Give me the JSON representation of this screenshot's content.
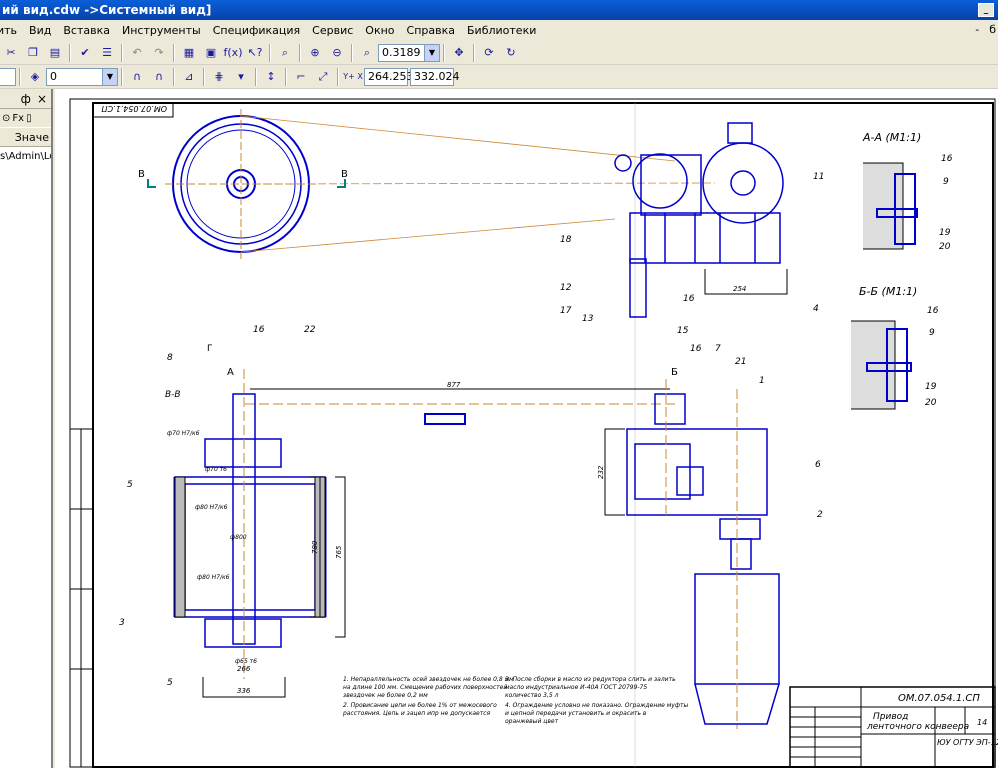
{
  "window": {
    "title": "ий вид.cdw ->Системный вид]",
    "restore_label": "_"
  },
  "menu": {
    "items": [
      "ить",
      "Вид",
      "Вставка",
      "Инструменты",
      "Спецификация",
      "Сервис",
      "Окно",
      "Справка",
      "Библиотеки"
    ],
    "right_controls": [
      "-",
      "б"
    ]
  },
  "toolbar1": {
    "zoom_value": "0.3189"
  },
  "toolbar2": {
    "layer_value": "0",
    "coord_x": "264.253",
    "coord_y": "332.024",
    "coord_label": "Y+ X"
  },
  "left_panel": {
    "header_controls": [
      "ф",
      "×"
    ],
    "column_header": "Значе",
    "row_text": "s\\Admin\\Lo"
  },
  "drawing": {
    "stamp_top": "ОМ.07.054.1.СП",
    "drawing_title_1": "Привод",
    "drawing_title_2": "ленточного конвеера",
    "sheet_number": "14",
    "group_code": "ЮУ ОГТУ ЭП-123",
    "corner_code": "ОМ.07.054.1.СП",
    "section_aa": "А-А (М1:1)",
    "section_bb": "Б-Б (М1:1)",
    "view_vv": "В-В",
    "view_g": "Г",
    "label_a": "А",
    "label_b": "Б",
    "label_v": "В",
    "dim_center": "877",
    "dim_254": "254",
    "dim_232": "232",
    "dim_780": "780",
    "dim_765": "765",
    "dim_336": "336",
    "dim_266": "266",
    "fit_1": "ф70 Н7/к6",
    "fit_2": "ф70 т6",
    "fit_3": "ф80 Н7/к6",
    "fit_4": "ф800",
    "fit_5": "ф80 Н7/к6",
    "fit_6": "ф65 т6",
    "part_numbers": [
      "16",
      "22",
      "8",
      "5",
      "3",
      "5",
      "1",
      "7",
      "21",
      "16",
      "6",
      "2",
      "11",
      "18",
      "12",
      "17",
      "13",
      "15",
      "16",
      "4",
      "16",
      "9",
      "19",
      "20",
      "16",
      "9",
      "19",
      "20"
    ],
    "notes_left_1": "1. Непараллельность осей звездочек не более 0,8 мм",
    "notes_left_2": "на длине 100 мм. Смещение рабочих поверхностей",
    "notes_left_3": "звездочек не более 0,2 мм",
    "notes_left_4": "2. Провисание цепи не более 1% от межосевого",
    "notes_left_5": "расстояния. Цепь и зацеп ипр не допускается",
    "notes_right_1": "3. После сборки в масло из редуктора слить и залить",
    "notes_right_2": "масло индустриальное И-40А ГОСТ 20799-75",
    "notes_right_3": "количество 3,5 л",
    "notes_right_4": "4. Ограждение условно не показано. Ограждение муфты",
    "notes_right_5": "и цепной передачи установить и окрасить в",
    "notes_right_6": "оранжевый цвет"
  },
  "colors": {
    "blue": "#0000cc",
    "orange": "#cc8833",
    "teal": "#008080"
  }
}
